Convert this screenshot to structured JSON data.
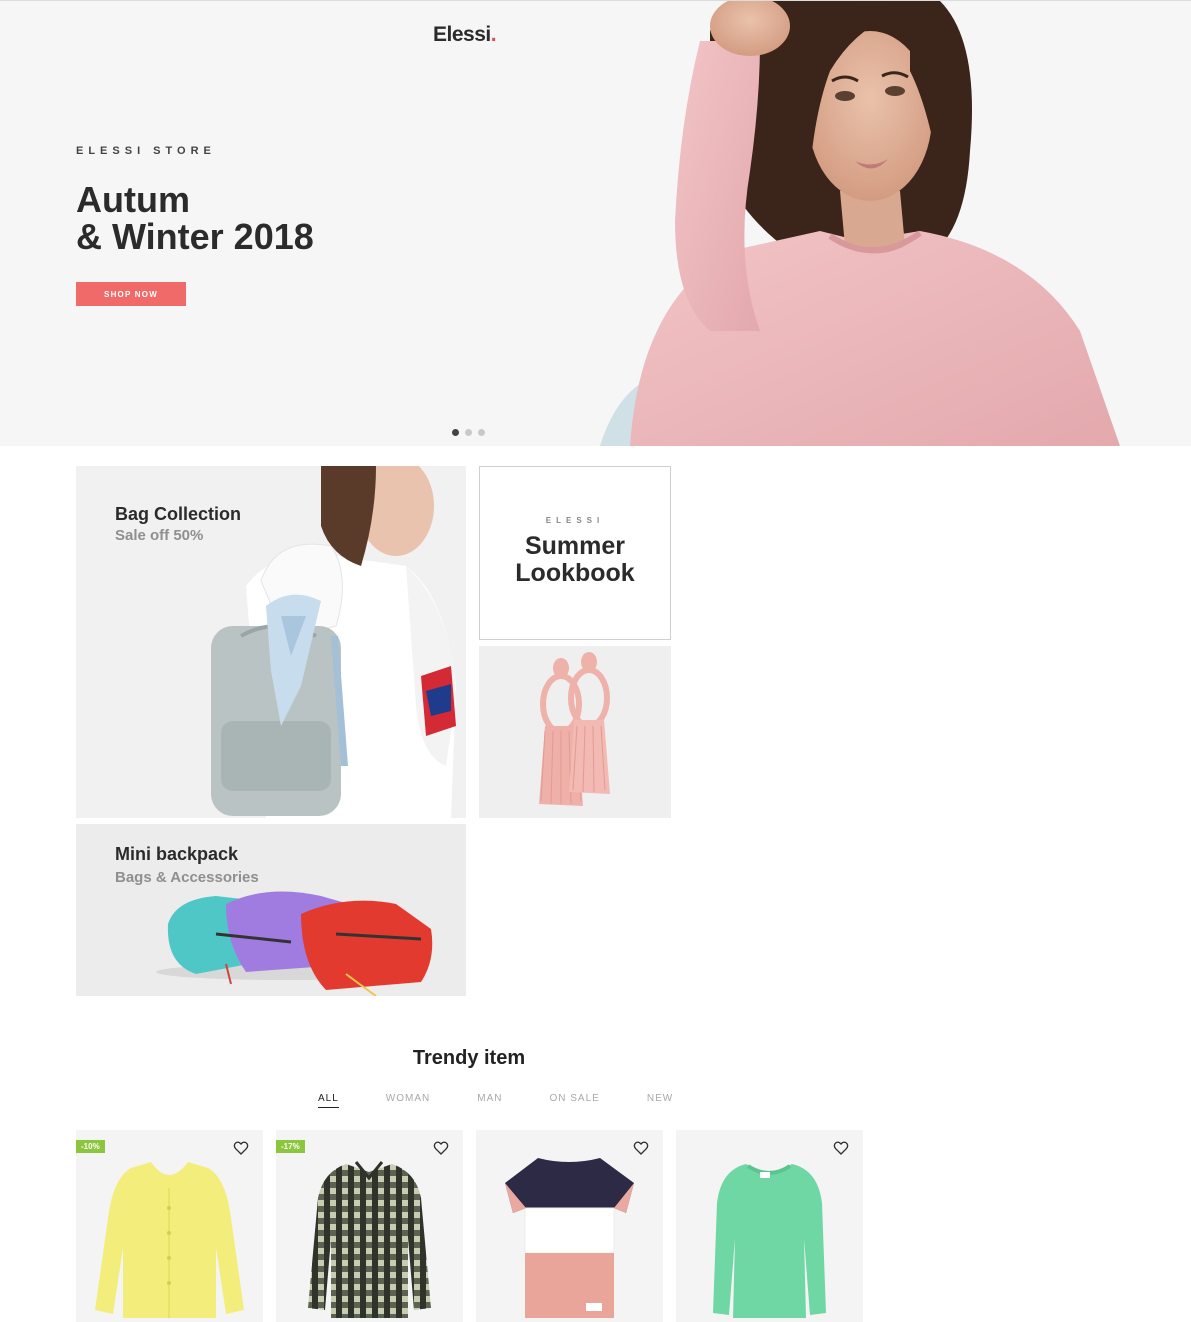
{
  "header": {
    "logo_text": "Elessi",
    "logo_dot": "."
  },
  "hero": {
    "eyebrow": "ELESSI STORE",
    "title_line1": "Autum",
    "title_line2": "& Winter 2018",
    "cta_label": "SHOP NOW",
    "slide_count": 3,
    "active_slide": 1,
    "accent_color": "#f16a6a"
  },
  "banners": {
    "bag": {
      "title": "Bag Collection",
      "subtitle": "Sale off 50%"
    },
    "lookbook": {
      "eyebrow": "ELESSI",
      "title_line1": "Summer",
      "title_line2": "Lookbook"
    },
    "mini": {
      "title": "Mini backpack",
      "subtitle": "Bags & Accessories"
    }
  },
  "trendy": {
    "title": "Trendy item",
    "tabs": [
      {
        "label": "ALL",
        "active": true
      },
      {
        "label": "WOMAN",
        "active": false
      },
      {
        "label": "MAN",
        "active": false
      },
      {
        "label": "ON SALE",
        "active": false
      },
      {
        "label": "NEW",
        "active": false
      }
    ],
    "products": [
      {
        "badge": "-10%",
        "image": "yellow-cardigan",
        "icon": "heart-icon"
      },
      {
        "badge": "-17%",
        "image": "plaid-shirt",
        "icon": "heart-icon"
      },
      {
        "badge": "",
        "image": "colorblock-tshirt",
        "icon": "heart-icon"
      },
      {
        "badge": "",
        "image": "green-sweater",
        "icon": "heart-icon"
      }
    ],
    "badge_color": "#8cc63f"
  }
}
